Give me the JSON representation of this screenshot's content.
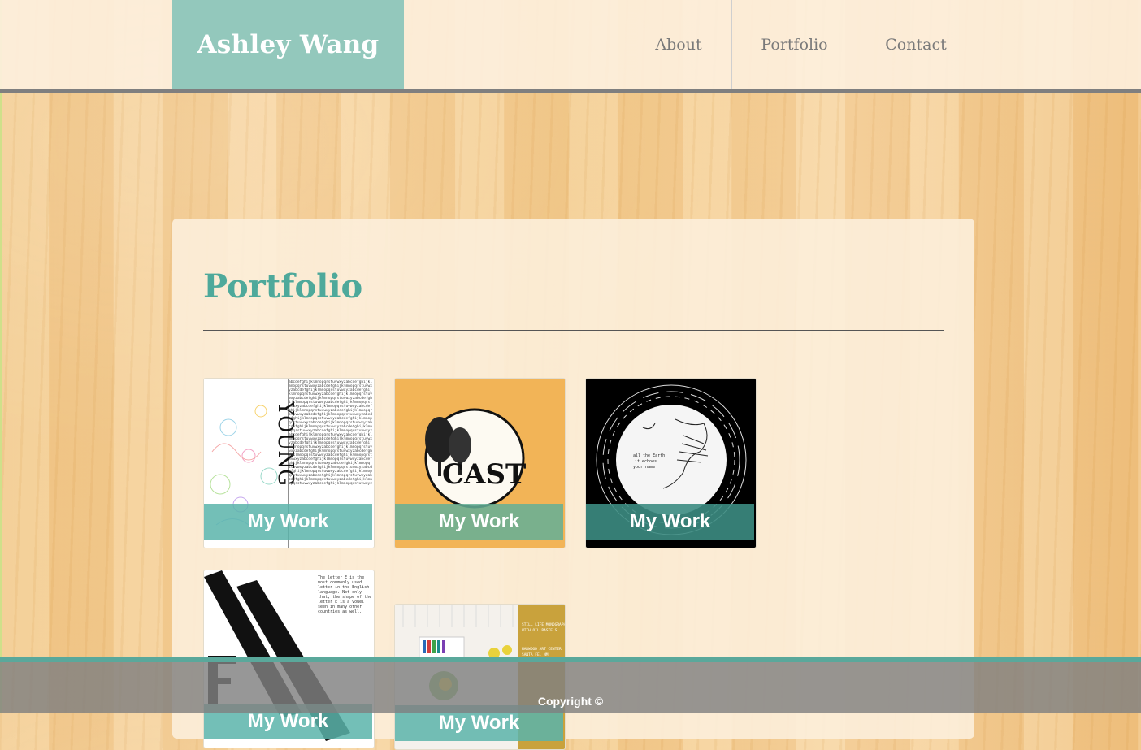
{
  "header": {
    "brand": "Ashley Wang",
    "nav": [
      {
        "label": "About"
      },
      {
        "label": "Portfolio"
      },
      {
        "label": "Contact"
      }
    ]
  },
  "main": {
    "title": "Portfolio",
    "items": [
      {
        "label": "My Work",
        "art_text": "YOUNG"
      },
      {
        "label": "My Work",
        "art_text": "CAST"
      },
      {
        "label": "My Work",
        "art_text": "all the Earth it echoes your name"
      },
      {
        "label": "My Work"
      },
      {
        "label": "My Work"
      }
    ]
  },
  "footer": {
    "copyright": "Copyright ©"
  },
  "colors": {
    "brand_bg": "#93c8bc",
    "accent_title": "#4ea99b",
    "footer_border": "#5aa89b",
    "nav_text": "#7a7a7a"
  }
}
